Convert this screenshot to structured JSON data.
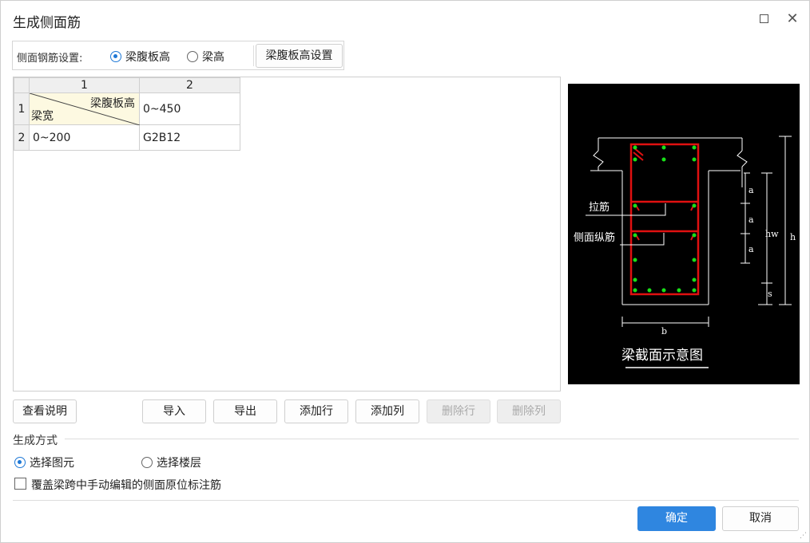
{
  "window": {
    "title": "生成侧面筋",
    "maximize_icon": "maximize-icon",
    "close_icon": "close-icon",
    "close_glyph": "✕"
  },
  "settings": {
    "label": "侧面钢筋设置:",
    "options": [
      {
        "label": "梁腹板高",
        "selected": true
      },
      {
        "label": "梁高",
        "selected": false
      }
    ],
    "config_button": "梁腹板高设置"
  },
  "grid": {
    "column_headers": [
      "1",
      "2"
    ],
    "header_row": {
      "row_number": "1",
      "diag_top_right": "梁腹板高",
      "diag_bottom_left": "梁宽",
      "cells": [
        "0~450"
      ]
    },
    "rows": [
      {
        "row_number": "2",
        "cells": [
          "0~200",
          "G2B12"
        ]
      }
    ]
  },
  "diagram": {
    "label_tie": "拉筋",
    "label_side_bar": "侧面纵筋",
    "dim_a": "a",
    "dim_hw": "hw",
    "dim_h": "h",
    "dim_s": "s",
    "dim_b": "b",
    "caption": "梁截面示意图",
    "colors": {
      "background": "#000000",
      "stirrup": "#e01010",
      "bar": "#18e018",
      "line": "#ffffff"
    }
  },
  "actions": {
    "help": "查看说明",
    "import": "导入",
    "export": "导出",
    "add_row": "添加行",
    "add_col": "添加列",
    "delete_row": "删除行",
    "delete_col": "删除列"
  },
  "generation": {
    "section_label": "生成方式",
    "options": [
      {
        "label": "选择图元",
        "selected": true
      },
      {
        "label": "选择楼层",
        "selected": false
      }
    ],
    "override_checkbox": {
      "label": "覆盖梁跨中手动编辑的侧面原位标注筋",
      "checked": false
    }
  },
  "footer": {
    "ok": "确定",
    "cancel": "取消"
  },
  "accent_color": "#2f86e0"
}
